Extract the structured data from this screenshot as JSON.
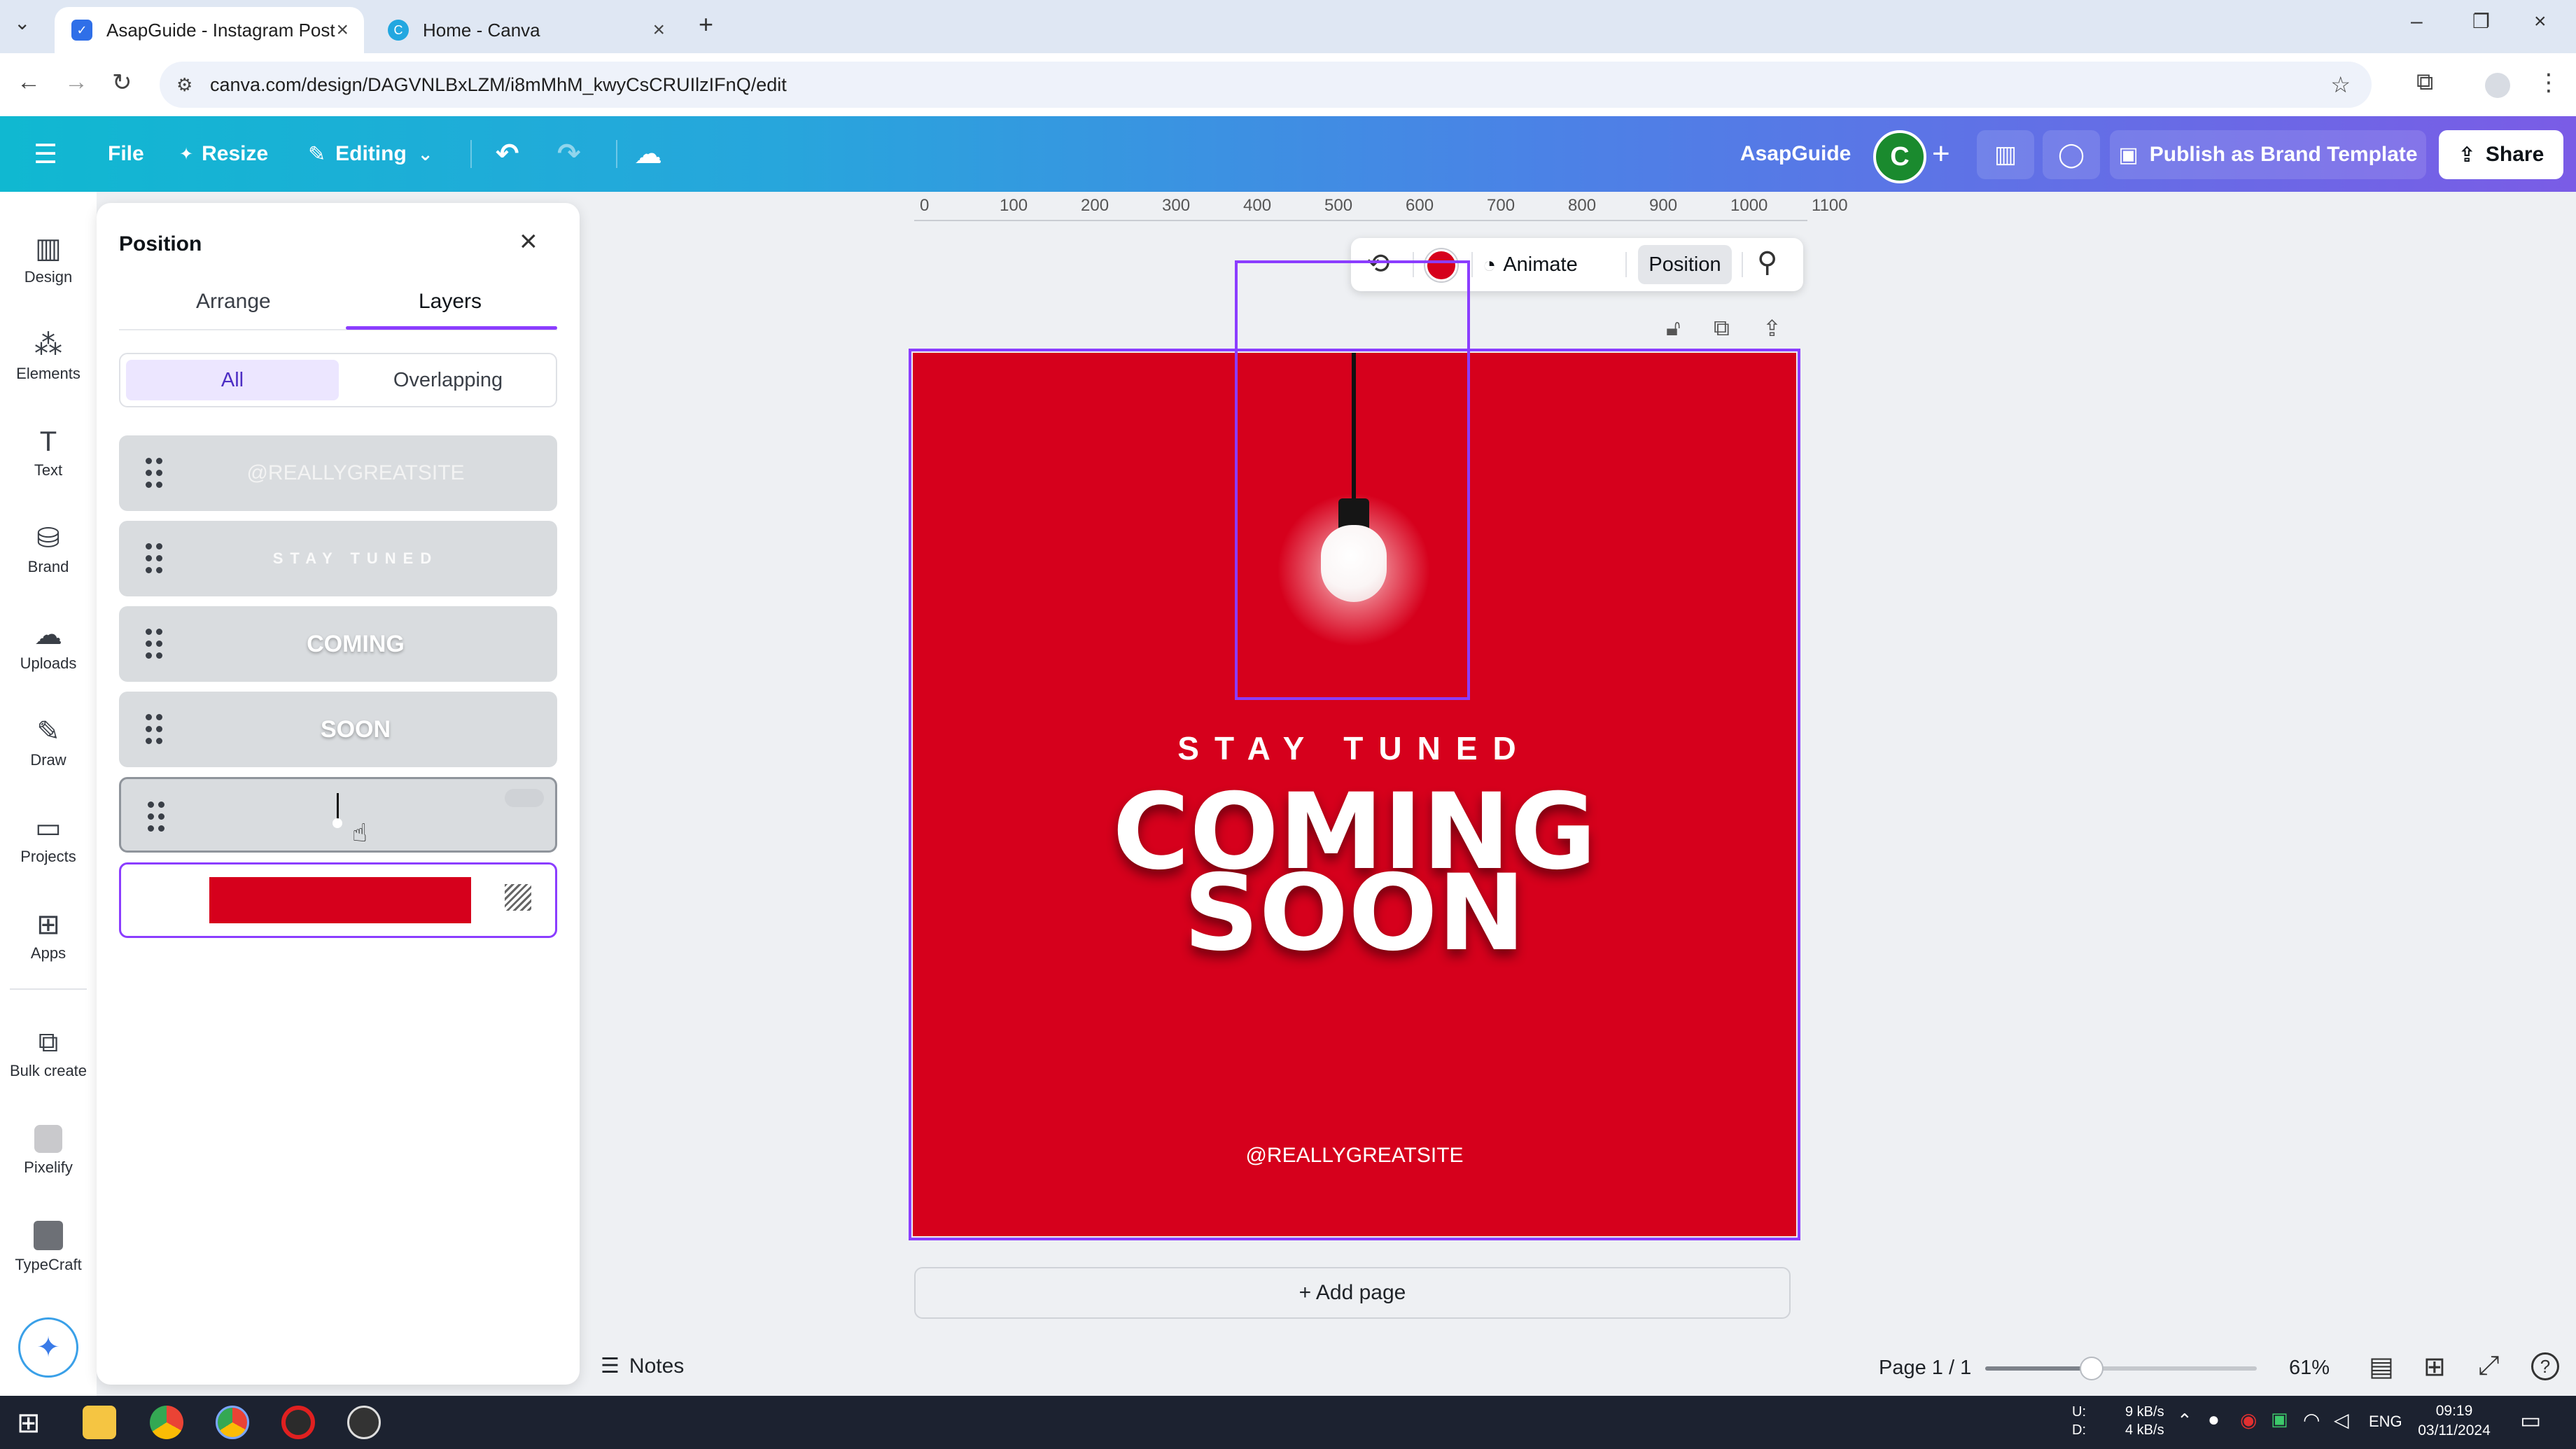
{
  "browser": {
    "tabs": [
      {
        "title": "AsapGuide - Instagram Post",
        "active": true
      },
      {
        "title": "Home - Canva",
        "active": false
      }
    ],
    "url": "canva.com/design/DAGVNLBxLZM/i8mMhM_kwyCsCRUIlzIFnQ/edit",
    "new_tab_symbol": "+"
  },
  "header": {
    "file": "File",
    "resize": "Resize",
    "editing": "Editing",
    "brand_name": "AsapGuide",
    "avatar_letter": "C",
    "publish": "Publish as Brand Template",
    "share": "Share"
  },
  "rail": [
    {
      "label": "Design",
      "icon": "design-icon"
    },
    {
      "label": "Elements",
      "icon": "elements-icon"
    },
    {
      "label": "Text",
      "icon": "text-icon"
    },
    {
      "label": "Brand",
      "icon": "brand-icon"
    },
    {
      "label": "Uploads",
      "icon": "uploads-icon"
    },
    {
      "label": "Draw",
      "icon": "draw-icon"
    },
    {
      "label": "Projects",
      "icon": "projects-icon"
    },
    {
      "label": "Apps",
      "icon": "apps-icon"
    },
    {
      "label": "Bulk create",
      "icon": "bulk-create-icon"
    },
    {
      "label": "Pixelify",
      "icon": "pixelify-icon"
    },
    {
      "label": "TypeCraft",
      "icon": "typecraft-icon"
    }
  ],
  "panel": {
    "title": "Position",
    "tabs": {
      "arrange": "Arrange",
      "layers": "Layers"
    },
    "filters": {
      "all": "All",
      "overlapping": "Overlapping"
    },
    "layers": [
      {
        "text": "@REALLYGREATSITE"
      },
      {
        "text": "STAY TUNED"
      },
      {
        "text": "COMING"
      },
      {
        "text": "SOON"
      },
      {
        "text": ""
      },
      {
        "text": ""
      }
    ]
  },
  "ruler": [
    "0",
    "100",
    "200",
    "300",
    "400",
    "500",
    "600",
    "700",
    "800",
    "900",
    "1000",
    "1100"
  ],
  "toolbar": {
    "animate": "Animate",
    "position": "Position",
    "color": "#d6001c"
  },
  "design": {
    "background": "#d6001c",
    "stay_tuned": "STAY TUNED",
    "coming": "COMING",
    "soon": "SOON",
    "site": "@REALLYGREATSITE"
  },
  "canvas": {
    "add_page": "+ Add page"
  },
  "footer": {
    "notes": "Notes",
    "page": "Page 1 / 1",
    "zoom": "61%",
    "zoom_level": 0.61
  },
  "taskbar": {
    "net_up_label": "U:",
    "net_down_label": "D:",
    "net_up": "9 kB/s",
    "net_down": "4 kB/s",
    "lang": "ENG",
    "time": "09:19",
    "date": "03/11/2024"
  }
}
